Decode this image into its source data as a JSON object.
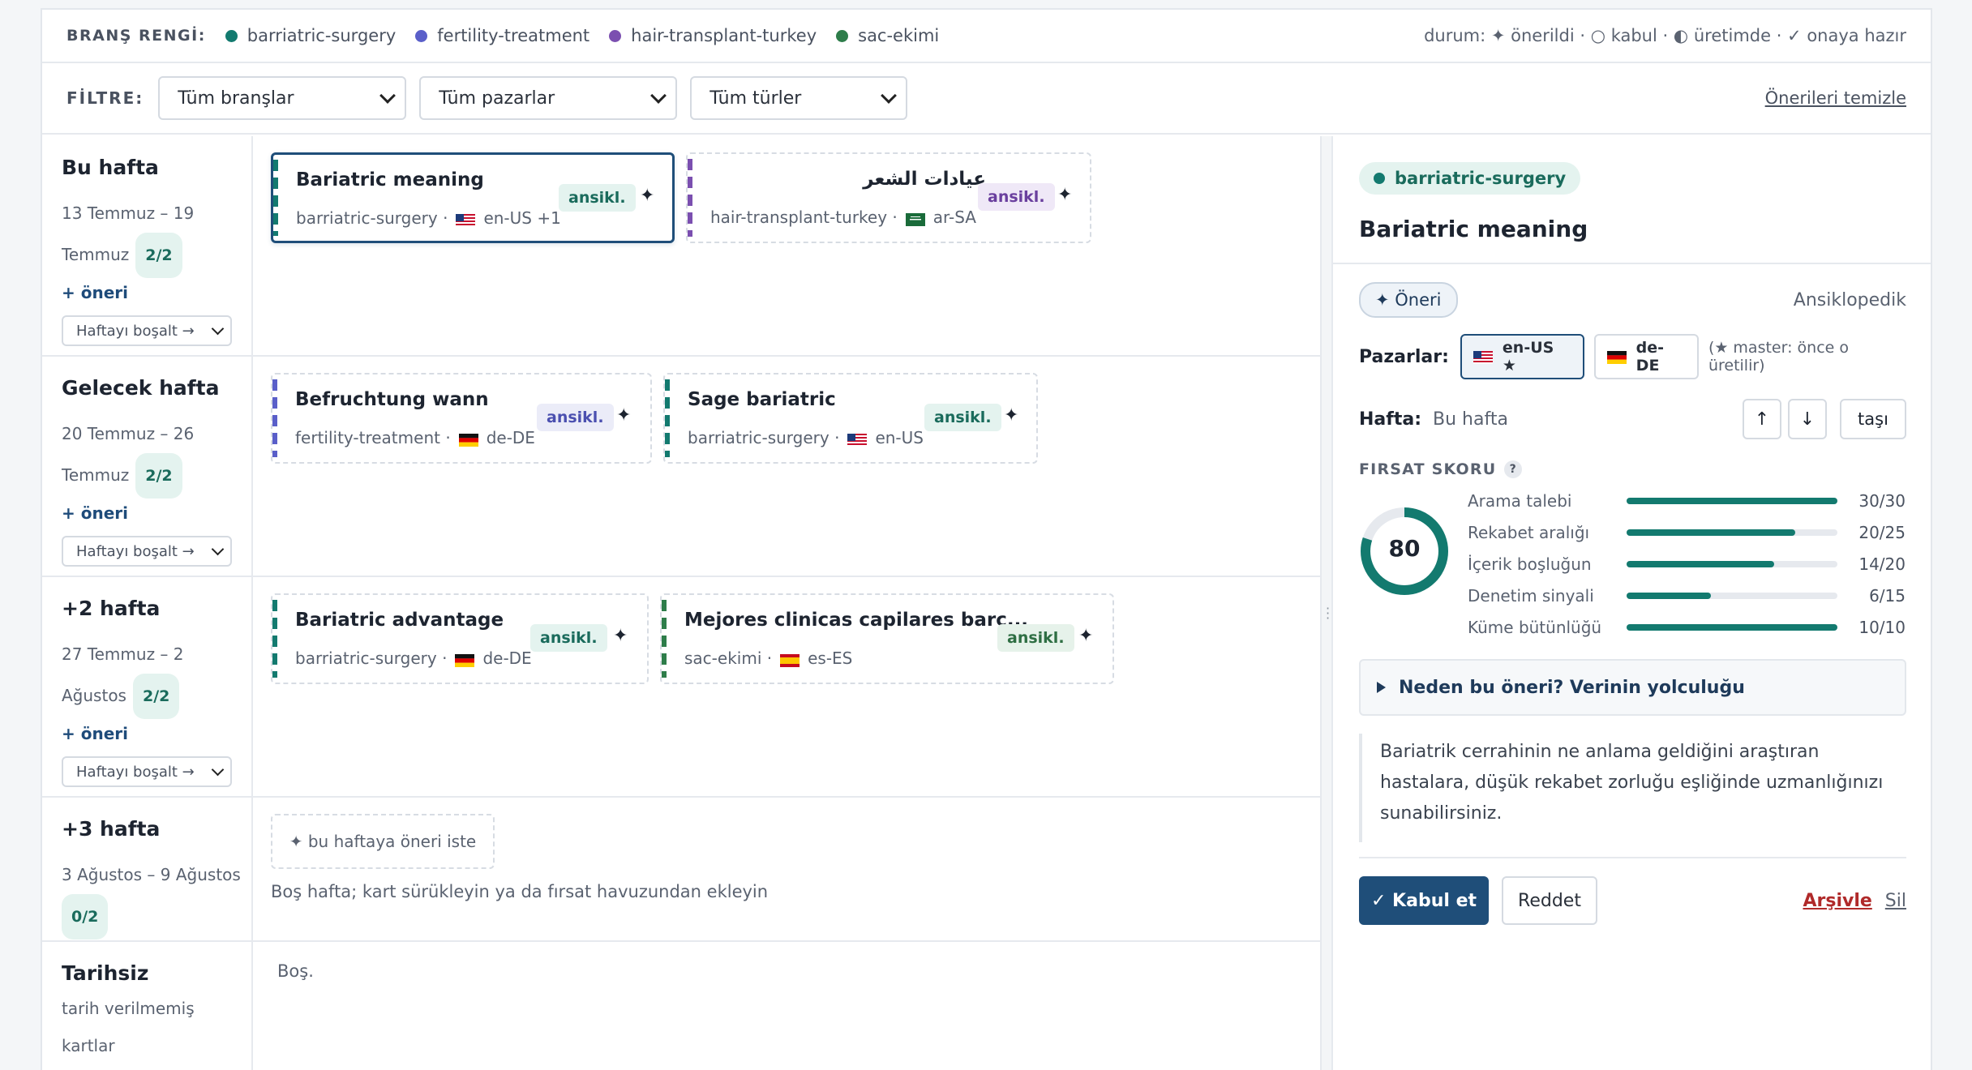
{
  "legend": {
    "label": "BRANŞ RENGİ:",
    "branches": [
      {
        "name": "barriatric-surgery",
        "color": "#137a6f"
      },
      {
        "name": "fertility-treatment",
        "color": "#5a5fc9"
      },
      {
        "name": "hair-transplant-turkey",
        "color": "#7b4fb0"
      },
      {
        "name": "sac-ekimi",
        "color": "#2e7d4a"
      }
    ],
    "status": "durum: ✦ önerildi · ○ kabul · ◐ üretimde · ✓ onaya hazır"
  },
  "filters": {
    "label": "FİLTRE:",
    "branch": "Tüm branşlar",
    "market": "Tüm pazarlar",
    "type": "Tüm türler",
    "clear": "Önerileri temizle"
  },
  "weeks": [
    {
      "title": "Bu hafta",
      "dates": "13 Temmuz – 19",
      "dates2": "Temmuz",
      "count": "2/2",
      "add": "+ öneri",
      "empty": "Haftayı boşalt →",
      "cards": [
        {
          "title": "Bariatric meaning",
          "branch": "barriatric-surgery",
          "market": "en-US +1",
          "tag": "ansikl."
        },
        {
          "title": "عيادات الشعر",
          "branch": "hair-transplant-turkey",
          "market": "ar-SA",
          "tag": "ansikl."
        }
      ]
    },
    {
      "title": "Gelecek hafta",
      "dates": "20 Temmuz – 26",
      "dates2": "Temmuz",
      "count": "2/2",
      "add": "+ öneri",
      "empty": "Haftayı boşalt →",
      "cards": [
        {
          "title": "Befruchtung wann",
          "branch": "fertility-treatment",
          "market": "de-DE",
          "tag": "ansikl."
        },
        {
          "title": "Sage bariatric",
          "branch": "barriatric-surgery",
          "market": "en-US",
          "tag": "ansikl."
        }
      ]
    },
    {
      "title": "+2 hafta",
      "dates": "27 Temmuz – 2",
      "dates2": "Ağustos",
      "count": "2/2",
      "add": "+ öneri",
      "empty": "Haftayı boşalt →",
      "cards": [
        {
          "title": "Bariatric advantage",
          "branch": "barriatric-surgery",
          "market": "de-DE",
          "tag": "ansikl."
        },
        {
          "title": "Mejores clinicas capilares barc...",
          "branch": "sac-ekimi",
          "market": "es-ES",
          "tag": "ansikl."
        }
      ]
    },
    {
      "title": "+3 hafta",
      "dates": "3 Ağustos – 9 Ağustos",
      "count": "0/2",
      "suggest": "✦ bu haftaya öneri iste",
      "empty_note": "Boş hafta; kart sürükleyin ya da fırsat havuzundan ekleyin"
    },
    {
      "title": "Tarihsiz",
      "dates": "tarih verilmemiş",
      "dates2": "kartlar",
      "empty_note": "Boş."
    }
  ],
  "detail": {
    "branch": "barriatric-surgery",
    "title": "Bariatric meaning",
    "status": "✦ Öneri",
    "type": "Ansiklopedik",
    "markets_label": "Pazarlar:",
    "markets": [
      "en-US ★",
      "de-DE"
    ],
    "markets_note": "(★ master: önce o üretilir)",
    "week_label": "Hafta:",
    "week_value": "Bu hafta",
    "up": "↑",
    "down": "↓",
    "move": "taşı",
    "score_label": "FIRSAT SKORU",
    "score_help": "?",
    "score": "80",
    "score_value": 80,
    "metrics": [
      {
        "name": "Arama talebi",
        "value": "30/30",
        "ratio": 1.0
      },
      {
        "name": "Rekabet aralığı",
        "value": "20/25",
        "ratio": 0.8
      },
      {
        "name": "İçerik boşluğun",
        "value": "14/20",
        "ratio": 0.7
      },
      {
        "name": "Denetim sinyali",
        "value": "6/15",
        "ratio": 0.4
      },
      {
        "name": "Küme bütünlüğü",
        "value": "10/10",
        "ratio": 1.0
      }
    ],
    "journey": "Neden bu öneri? Verinin yolculuğu",
    "description": "Bariatrik cerrahinin ne anlama geldiğini araştıran hastalara, düşük rekabet zorluğu eşliğinde uzmanlığınızı sunabilirsiniz.",
    "accept": "✓ Kabul et",
    "reject": "Reddet",
    "archive": "Arşivle",
    "delete": "Sil"
  }
}
